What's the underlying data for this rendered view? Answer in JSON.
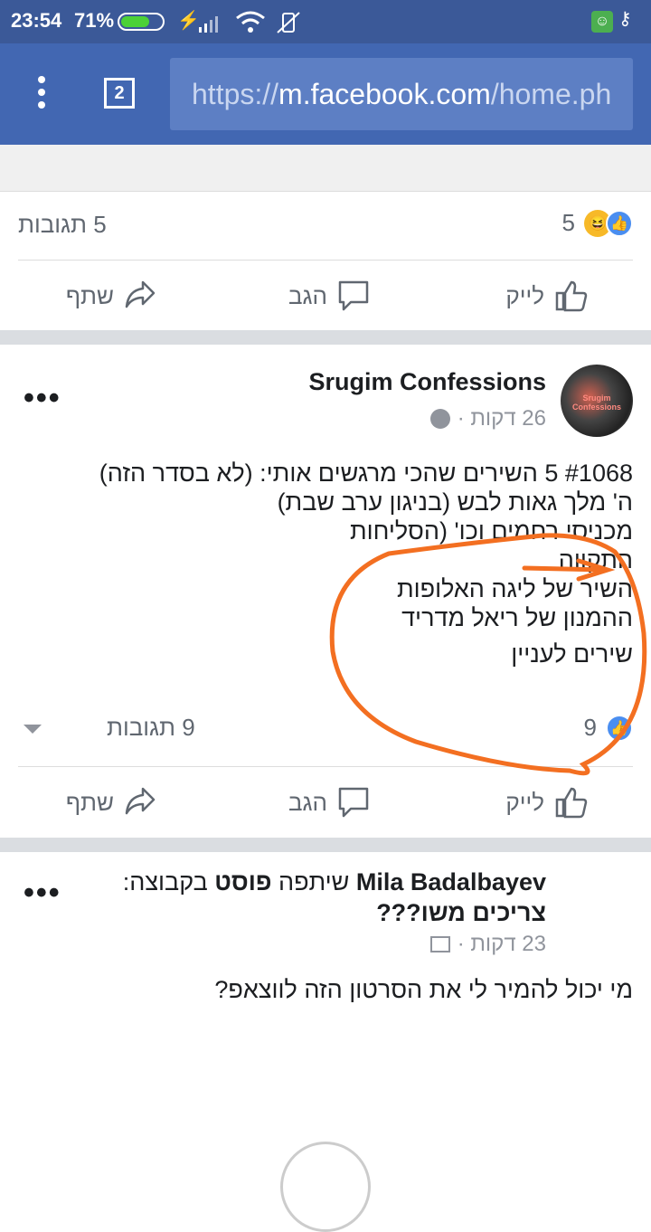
{
  "status_bar": {
    "time": "23:54",
    "battery_pct": "71%",
    "battery_level": 0.71
  },
  "browser": {
    "tab_count": "2",
    "url_scheme": "https://",
    "url_host": "m.facebook.com",
    "url_path": "/home.ph"
  },
  "post1": {
    "reactions_count": "5",
    "comments": "5 תגובות",
    "actions": {
      "like": "לייק",
      "comment": "הגב",
      "share": "שתף"
    }
  },
  "post2": {
    "author": "Srugim Confessions",
    "avatar_text": "Srugim Confessions",
    "time": "26 דקות ·",
    "lines": [
      "#1068 5 השירים שהכי מרגשים אותי: (לא בסדר הזה)",
      "ה' מלך גאות לבש (בניגון ערב שבת)",
      "מכניסי רחמים וכו' (הסליחות",
      "התקווה",
      "השיר של ליגה האלופות",
      "ההמנון של ריאל מדריד"
    ],
    "tag": "שירים לעניין",
    "reactions_count": "9",
    "comments": "9 תגובות",
    "actions": {
      "like": "לייק",
      "comment": "הגב",
      "share": "שתף"
    }
  },
  "post3": {
    "author": "Mila Badalbayev",
    "shared_text": "שיתפה",
    "post_word": "פוסט",
    "in_group": "בקבוצה:",
    "group": "צריכים משו???",
    "time": "23 דקות ·",
    "body": "מי יכול להמיר לי את הסרטון הזה לווצאפ?"
  },
  "colors": {
    "facebook_blue": "#4267b2",
    "status_blue": "#3b5998",
    "scribble": "#f36f21"
  }
}
